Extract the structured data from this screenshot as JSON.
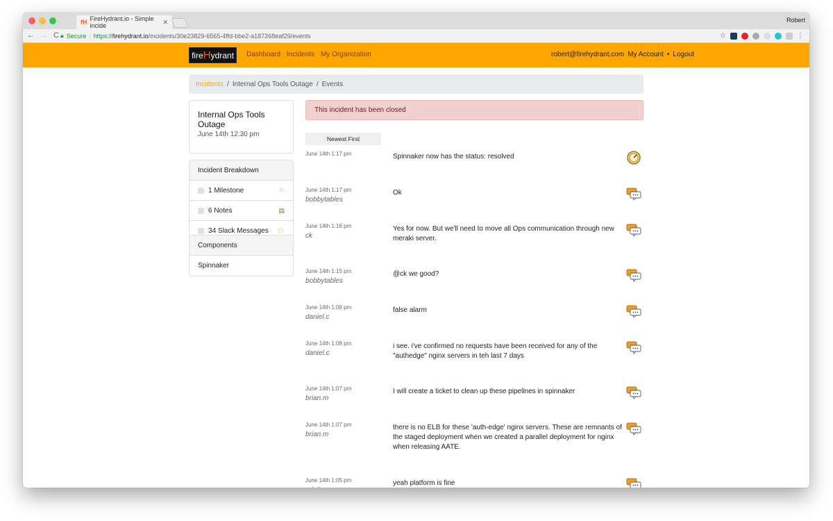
{
  "browser": {
    "tab_title": "FireHydrant.io - Simple incide",
    "profile": "Robert",
    "secure_label": "Secure",
    "url_scheme": "https://",
    "url_host": "firehydrant.io",
    "url_path": "/incidents/30e23829-6565-4ffd-bbe2-a187268eaf29/events"
  },
  "nav": {
    "logo_pre": "fire",
    "logo_h": "H",
    "logo_post": "ydrant",
    "links": [
      "Dashboard",
      "Incidents",
      "My Organization"
    ],
    "email": "robert@firehydrant.com",
    "account": "My Account",
    "separator": "•",
    "logout": "Logout"
  },
  "breadcrumb": {
    "items": [
      "Incidents",
      "Internal Ops Tools Outage",
      "Events"
    ],
    "separator": "/"
  },
  "incident": {
    "title": "Internal Ops Tools Outage",
    "date": "June 14th 12:30 pm"
  },
  "breakdown": {
    "heading": "Incident Breakdown",
    "items": [
      {
        "label": "1 Milestone",
        "icon": "milestone-icon"
      },
      {
        "label": "6 Notes",
        "icon": "note-icon"
      },
      {
        "label": "34 Slack Messages",
        "icon": "chat-icon"
      }
    ]
  },
  "components": {
    "heading": "Components",
    "items": [
      "Spinnaker"
    ]
  },
  "alert": {
    "text": "This incident has been closed"
  },
  "sort": {
    "label": "Newest First"
  },
  "events": [
    {
      "time": "June 14th 1:17 pm",
      "user": "",
      "text": "Spinnaker now has the status: resolved",
      "icon": "status-gauge-icon"
    },
    {
      "time": "June 14th 1:17 pm",
      "user": "bobbytables",
      "text": "Ok",
      "icon": "chat-bubble-icon"
    },
    {
      "time": "June 14th 1:16 pm",
      "user": "ck",
      "text": "Yes for now. But we'll need to move all Ops communication through new meraki server.",
      "icon": "chat-bubble-icon"
    },
    {
      "time": "June 14th 1:15 pm",
      "user": "bobbytables",
      "text": "@ck we good?",
      "icon": "chat-bubble-icon"
    },
    {
      "time": "June 14th 1:08 pm",
      "user": "daniel.c",
      "text": "false alarm",
      "icon": "chat-bubble-icon"
    },
    {
      "time": "June 14th 1:08 pm",
      "user": "daniel.c",
      "text": "i see. i've confirmed no requests have been received for any of the \"authedge\" nginx servers in teh last 7 days",
      "icon": "chat-bubble-icon"
    },
    {
      "time": "June 14th 1:07 pm",
      "user": "brian.m",
      "text": "I will create a ticket to clean up these pipelines in spinnaker",
      "icon": "chat-bubble-icon"
    },
    {
      "time": "June 14th 1:07 pm",
      "user": "brian.m",
      "text": "there is no ELB for these 'auth-edge' nginx servers. These are remnants of the staged deployment when we created a parallel deployment for nginx when releasing AATE.",
      "icon": "chat-bubble-icon"
    },
    {
      "time": "June 14th 1:05 pm",
      "user": "rob.hooper",
      "text": "yeah platform is fine",
      "icon": "chat-bubble-icon"
    }
  ],
  "colors": {
    "brand": "#ffa500",
    "alert_bg": "#f1d0d0",
    "alert_text": "#6b1a1a"
  }
}
